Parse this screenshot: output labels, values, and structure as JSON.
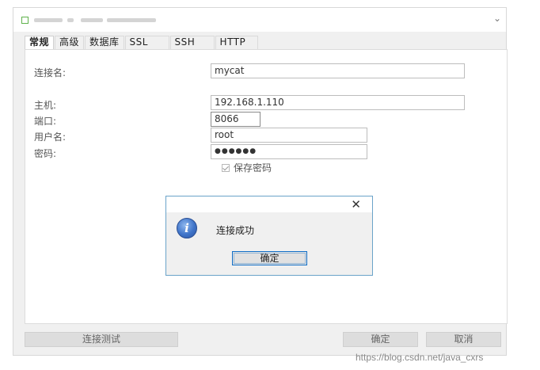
{
  "tabs": [
    "常规",
    "高级",
    "数据库",
    "SSL",
    "SSH",
    "HTTP"
  ],
  "form": {
    "connection_name_label": "连接名:",
    "connection_name_value": "mycat",
    "host_label": "主机:",
    "host_value": "192.168.1.110",
    "port_label": "端口:",
    "port_value": "8066",
    "user_label": "用户名:",
    "user_value": "root",
    "password_label": "密码:",
    "password_value": "●●●●●●",
    "save_password_label": "保存密码"
  },
  "bottom": {
    "test_connection": "连接测试",
    "ok": "确定",
    "cancel": "取消"
  },
  "dialog": {
    "message": "连接成功",
    "ok": "确定",
    "close_icon": "close-icon",
    "info_icon": "info-icon"
  },
  "watermark": "https://blog.csdn.net/java_cxrs",
  "colors": {
    "dialog_border": "#6aa3c9",
    "focus_button_border": "#0f6ec7",
    "info_icon": "#3f74c9"
  }
}
